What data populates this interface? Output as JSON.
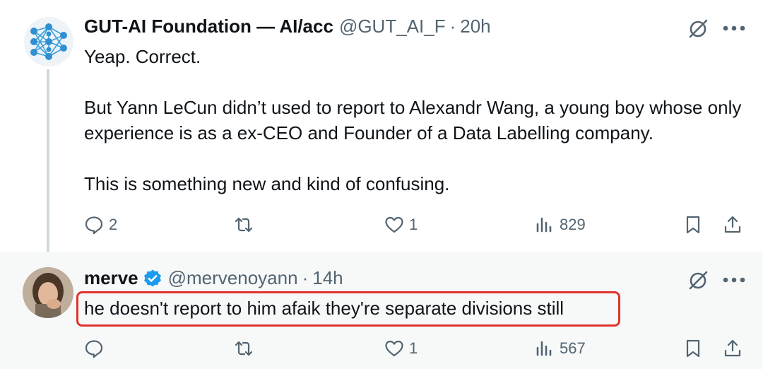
{
  "tweets": [
    {
      "author_name": "GUT-AI Foundation — AI/acc",
      "handle": "@GUT_AI_F",
      "separator": "·",
      "time": "20h",
      "body": "Yeap. Correct.\n\nBut Yann LeCun didn’t used to report to Alexandr Wang, a young boy whose only experience is as a ex-CEO and Founder of a Data Labelling company.\n\nThis is something new and kind of confusing.",
      "replies": "2",
      "retweets": "",
      "likes": "1",
      "views": "829"
    },
    {
      "author_name": "merve",
      "handle": "@mervenoyann",
      "separator": "·",
      "time": "14h",
      "verified": true,
      "body": "he doesn't report to him afaik they're separate divisions still",
      "replies": "",
      "retweets": "",
      "likes": "1",
      "views": "567"
    }
  ],
  "colors": {
    "text_primary": "#0f1419",
    "text_secondary": "#536471",
    "verified_blue": "#1d9bf0",
    "highlight_red": "#e0332c",
    "thread_line": "#cfd9de",
    "reply_bg": "#f7f9f9"
  },
  "icons": [
    "neural-network-logo",
    "grok-icon",
    "more-icon",
    "reply-icon",
    "retweet-icon",
    "like-icon",
    "views-icon",
    "bookmark-icon",
    "share-icon",
    "verified-badge-icon"
  ]
}
